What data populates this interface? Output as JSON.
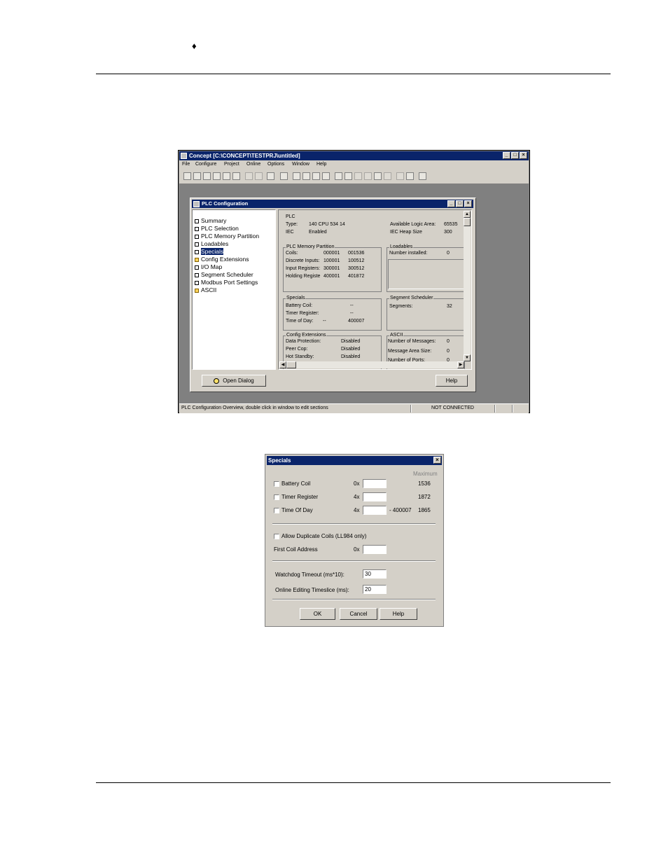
{
  "doc": {
    "bullet": "♦"
  },
  "concept": {
    "title": "Concept [C:\\CONCEPT\\TESTPRJ\\untitled]",
    "menu": [
      "File",
      "Configure",
      "Project",
      "Online",
      "Options",
      "Window",
      "Help"
    ],
    "status_text": "PLC Configuration Overview, double click in window to edit sections",
    "status_connection": "NOT CONNECTED"
  },
  "plc_config": {
    "title": "PLC Configuration",
    "tree": [
      "Summary",
      "PLC Selection",
      "PLC Memory Partition",
      "Loadables",
      "Specials",
      "Config Extensions",
      "I/O Map",
      "Segment Scheduler",
      "Modbus Port Settings",
      "ASCII"
    ],
    "selected": "Specials",
    "plc": {
      "header": "PLC",
      "type_label": "Type:",
      "type_value": "140 CPU 534 14",
      "iec_label": "IEC",
      "iec_value": "Enabled",
      "logic_label": "Available Logic Area:",
      "logic_value": "65535",
      "heap_label": "IEC Heap Size",
      "heap_value": "300"
    },
    "memory": {
      "header": "PLC Memory Partition",
      "rows": [
        {
          "label": "Coils:",
          "start": "000001",
          "end": "001536"
        },
        {
          "label": "Discrete Inputs:",
          "start": "100001",
          "end": "100512"
        },
        {
          "label": "Input Registers:",
          "start": "300001",
          "end": "300512"
        },
        {
          "label": "Holding Registe",
          "start": "400001",
          "end": "401872"
        }
      ]
    },
    "loadables": {
      "header": "Loadables",
      "label": "Number installed:",
      "value": "0"
    },
    "specials": {
      "header": "Specials",
      "battery_label": "Battery Coil:",
      "battery_value": "--",
      "timer_label": "Timer Register:",
      "timer_value": "--",
      "tod_label": "Time of Day:",
      "tod_a": "--",
      "tod_b": "400007"
    },
    "scheduler": {
      "header": "Segment Scheduler",
      "label": "Segments:",
      "value": "32"
    },
    "extensions": {
      "header": "Config Extensions",
      "rows": [
        {
          "label": "Data Protection:",
          "value": "Disabled"
        },
        {
          "label": "Peer Cop:",
          "value": "Disabled"
        },
        {
          "label": "Hot Standby:",
          "value": "Disabled"
        }
      ]
    },
    "ascii": {
      "header": "ASCII",
      "rows": [
        {
          "label": "Number of Messages:",
          "value": "0"
        },
        {
          "label": "Message Area Size:",
          "value": "0"
        },
        {
          "label": "Number of Ports:",
          "value": "0"
        }
      ]
    },
    "open_dialog": "Open Dialog",
    "help": "Help"
  },
  "specials_dialog": {
    "title": "Specials",
    "maximum_label": "Maximum",
    "battery": {
      "label": "Battery Coil",
      "prefix": "0x",
      "value": "",
      "max": "1536"
    },
    "timer": {
      "label": "Timer Register",
      "prefix": "4x",
      "value": "",
      "max": "1872"
    },
    "tod": {
      "label": "Time Of Day",
      "prefix": "4x",
      "value": "",
      "range": "- 400007",
      "max": "1865"
    },
    "allow_dup": "Allow Duplicate Coils (LL984 only)",
    "first_coil_label": "First Coil Address",
    "first_coil_prefix": "0x",
    "first_coil_value": "",
    "watchdog_label": "Watchdog Timeout (ms*10):",
    "watchdog_value": "30",
    "timeslice_label": "Online Editing Timeslice (ms):",
    "timeslice_value": "20",
    "ok": "OK",
    "cancel": "Cancel",
    "help": "Help"
  },
  "colors": {
    "titlebar": "#0a246a",
    "face": "#d4d0c8",
    "desktop": "#808080"
  }
}
